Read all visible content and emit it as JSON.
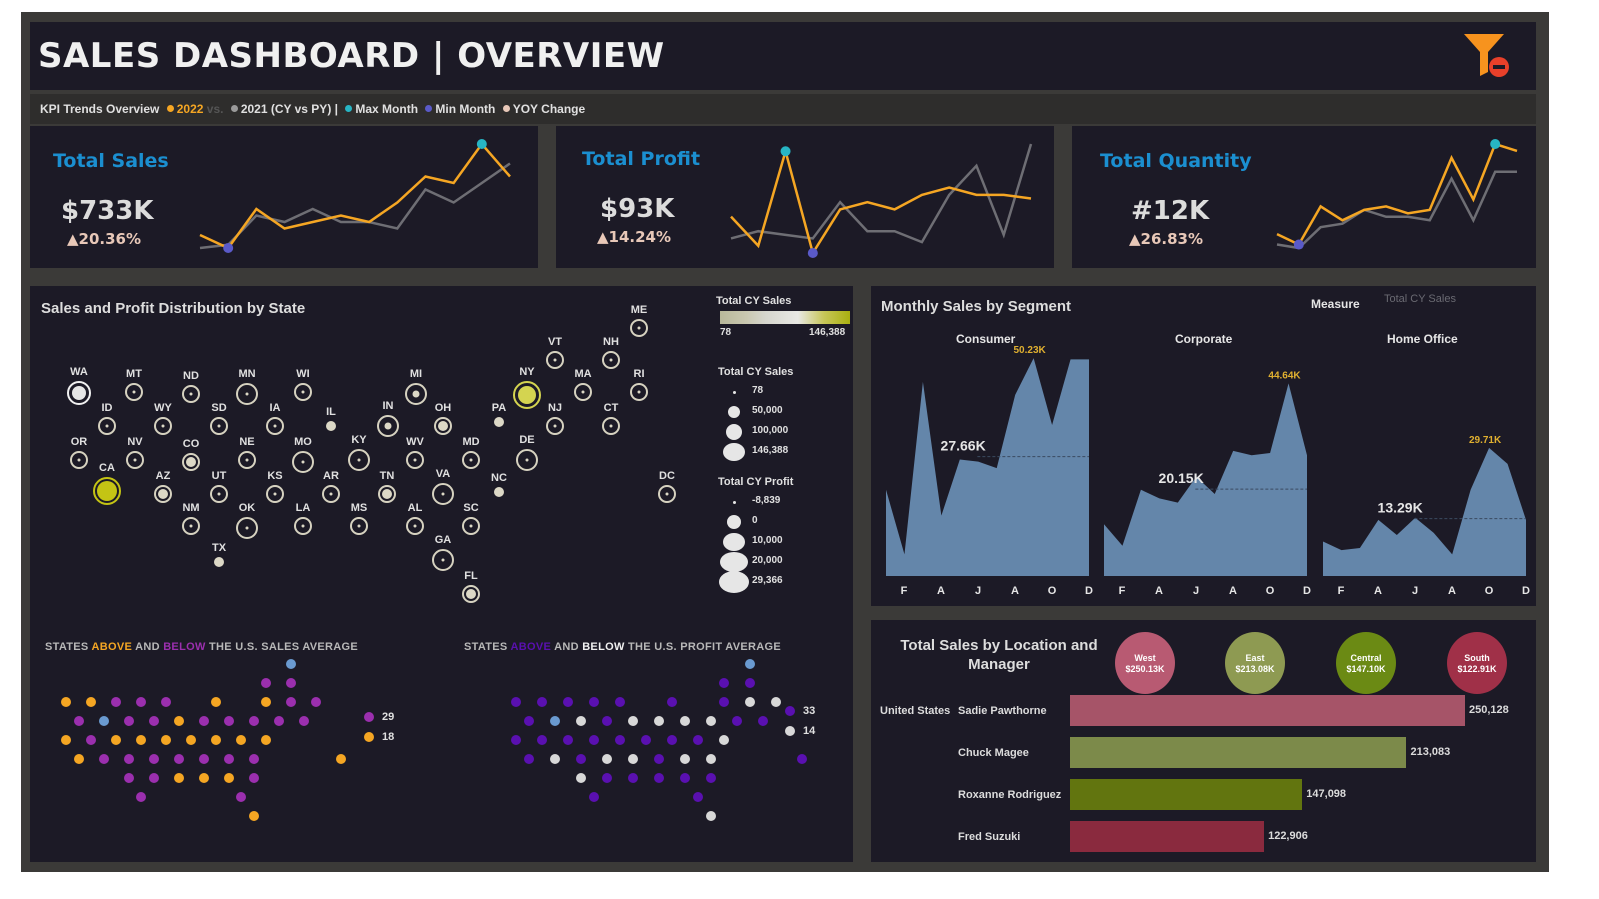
{
  "header": {
    "title": "SALES DASHBOARD | OVERVIEW",
    "filter_icon": "clear-filter-icon"
  },
  "subtitle": {
    "prefix": "KPI Trends Overview",
    "cy": "2022",
    "vs": "vs.",
    "py": "2021 (CY vs PY) |",
    "max": "Max Month",
    "min": "Min Month",
    "yoy": "YOY Change",
    "colors": {
      "cy": "#f5a623",
      "py": "#9a9a9a",
      "max": "#27b5c4",
      "min": "#5a5ac8",
      "yoy": "#e8c8b8"
    }
  },
  "kpis": [
    {
      "title": "Total Sales",
      "value": "$733K",
      "change": "▲20.36%",
      "cy": [
        5,
        3,
        9,
        6,
        7,
        8,
        7,
        10,
        14,
        13,
        19,
        14
      ],
      "py": [
        3,
        3.5,
        8,
        7,
        9,
        7,
        7,
        6,
        12,
        10,
        13,
        16
      ],
      "max_index": 10,
      "min_index": 1
    },
    {
      "title": "Total Profit",
      "value": "$93K",
      "change": "▲14.24%",
      "cy": [
        6,
        2,
        15,
        1,
        7,
        8,
        7,
        9,
        10,
        9,
        9,
        8.5
      ],
      "py": [
        3,
        4,
        3.5,
        3,
        8,
        4,
        4,
        2.5,
        9,
        13,
        3.5,
        16
      ],
      "max_index": 2,
      "min_index": 3
    },
    {
      "title": "Total Quantity",
      "value": "#12K",
      "change": "▲26.83%",
      "cy": [
        4,
        2.5,
        8,
        6,
        7.5,
        8,
        7,
        7.5,
        15,
        9,
        17,
        16
      ],
      "py": [
        2.5,
        2,
        5,
        5.5,
        7.5,
        6.5,
        6.5,
        6,
        12,
        6,
        13,
        13
      ],
      "max_index": 10,
      "min_index": 1
    }
  ],
  "state_map": {
    "title": "Sales and Profit Distribution by State",
    "color_legend": {
      "title": "Total CY Sales",
      "min": "78",
      "max": "146,388"
    },
    "size_legend_sales": {
      "title": "Total CY Sales",
      "items": [
        "78",
        "50,000",
        "100,000",
        "146,388"
      ]
    },
    "size_legend_profit": {
      "title": "Total CY Profit",
      "items": [
        "-8,839",
        "0",
        "10,000",
        "20,000",
        "29,366"
      ]
    },
    "states": [
      {
        "code": "WA",
        "s": 3,
        "p": 3,
        "hl": "white"
      },
      {
        "code": "MT",
        "s": 1,
        "p": 1
      },
      {
        "code": "ND",
        "s": 1,
        "p": 1
      },
      {
        "code": "MN",
        "s": 1,
        "p": 2
      },
      {
        "code": "WI",
        "s": 1,
        "p": 1
      },
      {
        "code": "MI",
        "s": 2,
        "p": 2
      },
      {
        "code": "ID",
        "s": 1,
        "p": 1
      },
      {
        "code": "WY",
        "s": 1,
        "p": 1
      },
      {
        "code": "SD",
        "s": 1,
        "p": 1
      },
      {
        "code": "IA",
        "s": 1,
        "p": 1
      },
      {
        "code": "IL",
        "s": 0,
        "p": 0
      },
      {
        "code": "IN",
        "s": 2,
        "p": 2
      },
      {
        "code": "OH",
        "s": 0,
        "p": 1
      },
      {
        "code": "OR",
        "s": 1,
        "p": 1
      },
      {
        "code": "NV",
        "s": 1,
        "p": 1
      },
      {
        "code": "CO",
        "s": 0,
        "p": 1
      },
      {
        "code": "NE",
        "s": 1,
        "p": 1
      },
      {
        "code": "MO",
        "s": 1,
        "p": 2
      },
      {
        "code": "KY",
        "s": 1,
        "p": 2
      },
      {
        "code": "WV",
        "s": 1,
        "p": 1
      },
      {
        "code": "CA",
        "s": 3,
        "p": 3,
        "hl": "yellow"
      },
      {
        "code": "AZ",
        "s": 0,
        "p": 1
      },
      {
        "code": "UT",
        "s": 1,
        "p": 1
      },
      {
        "code": "KS",
        "s": 1,
        "p": 1
      },
      {
        "code": "AR",
        "s": 1,
        "p": 1
      },
      {
        "code": "TN",
        "s": 0,
        "p": 1
      },
      {
        "code": "VA",
        "s": 1,
        "p": 2
      },
      {
        "code": "NM",
        "s": 1,
        "p": 1
      },
      {
        "code": "OK",
        "s": 1,
        "p": 2
      },
      {
        "code": "LA",
        "s": 1,
        "p": 1
      },
      {
        "code": "MS",
        "s": 1,
        "p": 1
      },
      {
        "code": "AL",
        "s": 1,
        "p": 1
      },
      {
        "code": "SC",
        "s": 1,
        "p": 1
      },
      {
        "code": "NC",
        "s": 0,
        "p": 0
      },
      {
        "code": "TX",
        "s": 0,
        "p": 0
      },
      {
        "code": "GA",
        "s": 1,
        "p": 2
      },
      {
        "code": "FL",
        "s": 0,
        "p": 1
      },
      {
        "code": "ME",
        "s": 1,
        "p": 1
      },
      {
        "code": "VT",
        "s": 1,
        "p": 1
      },
      {
        "code": "NH",
        "s": 1,
        "p": 1
      },
      {
        "code": "NY",
        "s": 3,
        "p": 3,
        "hl": "yellow-light"
      },
      {
        "code": "MA",
        "s": 1,
        "p": 1
      },
      {
        "code": "RI",
        "s": 1,
        "p": 1
      },
      {
        "code": "PA",
        "s": 0,
        "p": 0
      },
      {
        "code": "NJ",
        "s": 1,
        "p": 1
      },
      {
        "code": "CT",
        "s": 1,
        "p": 1
      },
      {
        "code": "MD",
        "s": 1,
        "p": 1
      },
      {
        "code": "DE",
        "s": 1,
        "p": 2
      },
      {
        "code": "DC",
        "s": 1,
        "p": 1
      }
    ]
  },
  "sales_avg": {
    "title_pre": "STATES ",
    "title_above": "ABOVE",
    "title_mid": " AND ",
    "title_below": "BELOW",
    "title_post": " THE U.S. SALES AVERAGE",
    "below_count": "29",
    "above_count": "18",
    "colors": {
      "above": "#f5a623",
      "below": "#9b2fae",
      "neutral": "#6a9ad0"
    }
  },
  "profit_avg": {
    "title_pre": "STATES ",
    "title_above": "ABOVE",
    "title_mid": " AND ",
    "title_below": "BELOW",
    "title_post": " THE U.S. PROFIT AVERAGE",
    "above_count": "33",
    "below_count": "14",
    "colors": {
      "above": "#5a10b0",
      "below": "#d8d8d8",
      "neutral": "#6a9ad0"
    }
  },
  "segment_chart": {
    "title": "Monthly Sales by Segment",
    "measure_label": "Measure",
    "measure_value": "Total CY Sales",
    "months": [
      "F",
      "A",
      "J",
      "A",
      "O",
      "D"
    ],
    "segments": [
      {
        "name": "Consumer",
        "avg_label": "27.66K",
        "max_label": "50.23K",
        "values": [
          20,
          5,
          45,
          14,
          27,
          26.5,
          25,
          42,
          50.5,
          35,
          50.23,
          50.23
        ]
      },
      {
        "name": "Corporate",
        "avg_label": "20.15K",
        "max_label": "44.64K",
        "values": [
          12,
          7,
          20,
          18,
          17,
          23,
          19,
          29,
          28,
          28.5,
          44.64,
          28
        ]
      },
      {
        "name": "Home Office",
        "avg_label": "13.29K",
        "max_label": "29.71K",
        "values": [
          8,
          6,
          6.5,
          13,
          9.5,
          13.5,
          10,
          5,
          20,
          29.71,
          26,
          13
        ]
      }
    ]
  },
  "chart_data": {
    "type": "bar",
    "title": "Total Sales by Location and Manager",
    "row_label": "United States",
    "categories": [
      "Sadie Pawthorne",
      "Chuck Magee",
      "Roxanne Rodriguez",
      "Fred Suzuki"
    ],
    "values": [
      250128,
      213083,
      147098,
      122906
    ],
    "value_labels": [
      "250,128",
      "213,083",
      "147,098",
      "122,906"
    ],
    "colors": [
      "#a65468",
      "#7c8a4a",
      "#62750f",
      "#8a2a3e"
    ],
    "regions": [
      {
        "name": "West",
        "value": "$250.13K",
        "color": "#b85a72"
      },
      {
        "name": "East",
        "value": "$213.08K",
        "color": "#8e9a52"
      },
      {
        "name": "Central",
        "value": "$147.10K",
        "color": "#6b8a14"
      },
      {
        "name": "South",
        "value": "$122.91K",
        "color": "#a03048"
      }
    ]
  }
}
